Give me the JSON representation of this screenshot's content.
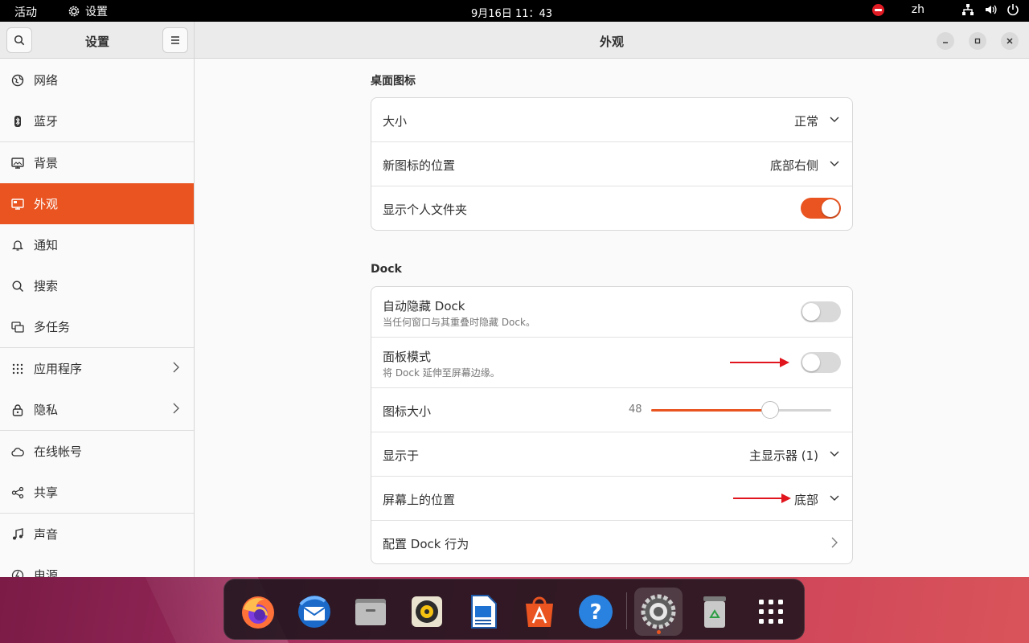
{
  "topbar": {
    "activities": "活动",
    "app_name": "设置",
    "clock": "9月16日  11：43",
    "language": "zh",
    "icons": [
      "do-not-disturb-icon",
      "network-icon",
      "volume-icon",
      "power-icon"
    ]
  },
  "sidebar": {
    "title": "设置",
    "items": [
      {
        "label": "网络",
        "icon": "globe-icon"
      },
      {
        "label": "蓝牙",
        "icon": "bluetooth-icon"
      },
      {
        "label": "背景",
        "icon": "monitor-icon"
      },
      {
        "label": "外观",
        "icon": "appearance-icon",
        "active": true
      },
      {
        "label": "通知",
        "icon": "bell-icon"
      },
      {
        "label": "搜索",
        "icon": "search-icon"
      },
      {
        "label": "多任务",
        "icon": "multitask-icon"
      },
      {
        "label": "应用程序",
        "icon": "apps-grid-icon"
      },
      {
        "label": "隐私",
        "icon": "lock-icon"
      },
      {
        "label": "在线帐号",
        "icon": "cloud-icon"
      },
      {
        "label": "共享",
        "icon": "share-icon"
      },
      {
        "label": "声音",
        "icon": "music-note-icon"
      },
      {
        "label": "电源",
        "icon": "power-icon"
      }
    ]
  },
  "main": {
    "title": "外观",
    "desktop_icons": {
      "section_title": "桌面图标",
      "size_label": "大小",
      "size_value": "正常",
      "new_icon_pos_label": "新图标的位置",
      "new_icon_pos_value": "底部右侧",
      "show_home_label": "显示个人文件夹",
      "show_home_on": true
    },
    "dock": {
      "section_title": "Dock",
      "autohide_label": "自动隐藏 Dock",
      "autohide_sub": "当任何窗口与其重叠时隐藏 Dock。",
      "autohide_on": false,
      "panel_mode_label": "面板模式",
      "panel_mode_sub": "将 Dock 延伸至屏幕边缘。",
      "panel_mode_on": false,
      "icon_size_label": "图标大小",
      "icon_size_value": "48",
      "icon_size_fraction": 0.66,
      "show_on_label": "显示于",
      "show_on_value": "主显示器 (1)",
      "position_label": "屏幕上的位置",
      "position_value": "底部",
      "configure_label": "配置 Dock 行为"
    }
  },
  "dock_apps": [
    "firefox-icon",
    "thunderbird-icon",
    "files-icon",
    "rhythmbox-icon",
    "writer-icon",
    "app-center-icon",
    "help-icon",
    "settings-icon",
    "trash-icon",
    "show-apps-icon"
  ],
  "colors": {
    "accent": "#e95420",
    "annotation_arrow": "#e0151d"
  }
}
